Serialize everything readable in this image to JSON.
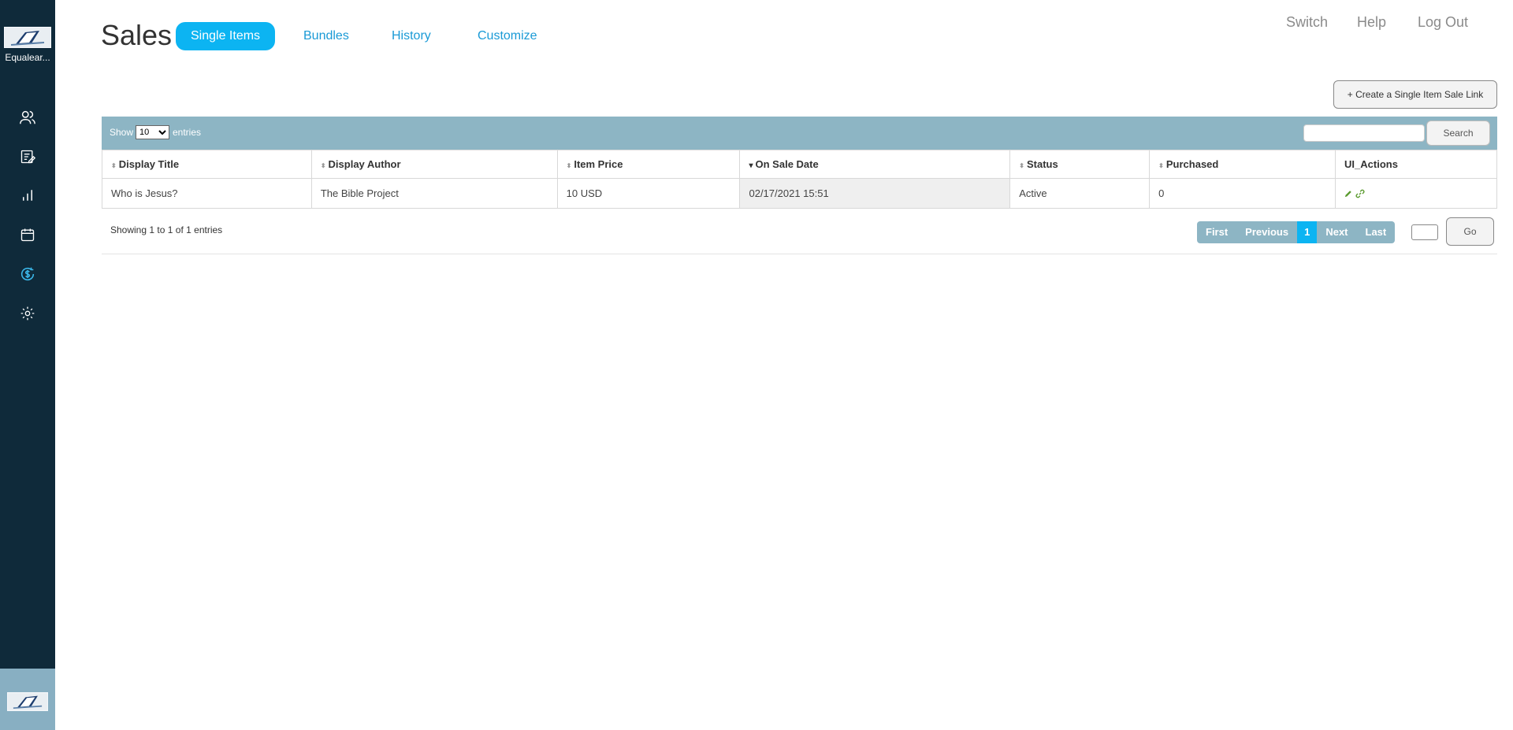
{
  "sidebar": {
    "org_name": "Equalear...",
    "nav": [
      {
        "icon": "users-icon"
      },
      {
        "icon": "edit-note-icon"
      },
      {
        "icon": "bar-chart-icon"
      },
      {
        "icon": "calendar-icon"
      },
      {
        "icon": "dollar-circle-icon",
        "active": true
      },
      {
        "icon": "gear-icon"
      }
    ]
  },
  "header": {
    "title": "Sales",
    "tabs": [
      {
        "label": "Single Items",
        "active": true
      },
      {
        "label": "Bundles"
      },
      {
        "label": "History"
      },
      {
        "label": "Customize"
      }
    ],
    "links": [
      "Switch",
      "Help",
      "Log Out"
    ]
  },
  "create_button": "+ Create a Single Item Sale Link",
  "table_controls": {
    "show_label": "Show",
    "entries_value": "10",
    "entries_label": "entries",
    "search_value": "",
    "search_button": "Search"
  },
  "table": {
    "columns": [
      "Display Title",
      "Display Author",
      "Item Price",
      "On Sale Date",
      "Status",
      "Purchased",
      "UI_Actions"
    ],
    "sorted_column": "On Sale Date",
    "rows": [
      {
        "title": "Who is Jesus?",
        "author": "The Bible Project",
        "price": "10 USD",
        "on_sale_date": "02/17/2021 15:51",
        "status": "Active",
        "purchased": "0",
        "actions": [
          "pencil-icon",
          "link-icon"
        ]
      }
    ]
  },
  "footer": {
    "info_prefix": "Showing ",
    "info_from": "1",
    "info_to_word": " to ",
    "info_to": "1",
    "info_of_word": " of ",
    "info_total": "1",
    "info_suffix": " entries",
    "pager": [
      "First",
      "Previous",
      "1",
      "Next",
      "Last"
    ],
    "current_page": "1",
    "page_input_value": "",
    "go_button": "Go"
  },
  "colors": {
    "sidebar_bg": "#0f2a3a",
    "accent": "#0cb4f2",
    "toolbar_bg": "#8db5c4",
    "link": "#1a9ad6",
    "action_icon": "#5a9a2e"
  }
}
